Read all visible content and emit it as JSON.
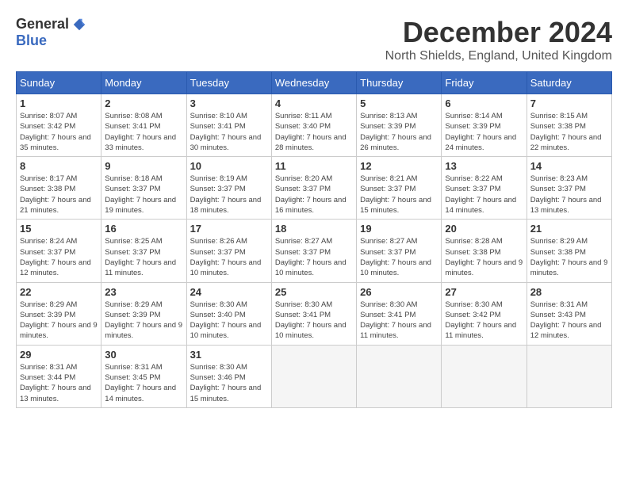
{
  "logo": {
    "general": "General",
    "blue": "Blue"
  },
  "title": "December 2024",
  "location": "North Shields, England, United Kingdom",
  "days_of_week": [
    "Sunday",
    "Monday",
    "Tuesday",
    "Wednesday",
    "Thursday",
    "Friday",
    "Saturday"
  ],
  "weeks": [
    [
      {
        "day": "1",
        "sunrise": "Sunrise: 8:07 AM",
        "sunset": "Sunset: 3:42 PM",
        "daylight": "Daylight: 7 hours and 35 minutes."
      },
      {
        "day": "2",
        "sunrise": "Sunrise: 8:08 AM",
        "sunset": "Sunset: 3:41 PM",
        "daylight": "Daylight: 7 hours and 33 minutes."
      },
      {
        "day": "3",
        "sunrise": "Sunrise: 8:10 AM",
        "sunset": "Sunset: 3:41 PM",
        "daylight": "Daylight: 7 hours and 30 minutes."
      },
      {
        "day": "4",
        "sunrise": "Sunrise: 8:11 AM",
        "sunset": "Sunset: 3:40 PM",
        "daylight": "Daylight: 7 hours and 28 minutes."
      },
      {
        "day": "5",
        "sunrise": "Sunrise: 8:13 AM",
        "sunset": "Sunset: 3:39 PM",
        "daylight": "Daylight: 7 hours and 26 minutes."
      },
      {
        "day": "6",
        "sunrise": "Sunrise: 8:14 AM",
        "sunset": "Sunset: 3:39 PM",
        "daylight": "Daylight: 7 hours and 24 minutes."
      },
      {
        "day": "7",
        "sunrise": "Sunrise: 8:15 AM",
        "sunset": "Sunset: 3:38 PM",
        "daylight": "Daylight: 7 hours and 22 minutes."
      }
    ],
    [
      {
        "day": "8",
        "sunrise": "Sunrise: 8:17 AM",
        "sunset": "Sunset: 3:38 PM",
        "daylight": "Daylight: 7 hours and 21 minutes."
      },
      {
        "day": "9",
        "sunrise": "Sunrise: 8:18 AM",
        "sunset": "Sunset: 3:37 PM",
        "daylight": "Daylight: 7 hours and 19 minutes."
      },
      {
        "day": "10",
        "sunrise": "Sunrise: 8:19 AM",
        "sunset": "Sunset: 3:37 PM",
        "daylight": "Daylight: 7 hours and 18 minutes."
      },
      {
        "day": "11",
        "sunrise": "Sunrise: 8:20 AM",
        "sunset": "Sunset: 3:37 PM",
        "daylight": "Daylight: 7 hours and 16 minutes."
      },
      {
        "day": "12",
        "sunrise": "Sunrise: 8:21 AM",
        "sunset": "Sunset: 3:37 PM",
        "daylight": "Daylight: 7 hours and 15 minutes."
      },
      {
        "day": "13",
        "sunrise": "Sunrise: 8:22 AM",
        "sunset": "Sunset: 3:37 PM",
        "daylight": "Daylight: 7 hours and 14 minutes."
      },
      {
        "day": "14",
        "sunrise": "Sunrise: 8:23 AM",
        "sunset": "Sunset: 3:37 PM",
        "daylight": "Daylight: 7 hours and 13 minutes."
      }
    ],
    [
      {
        "day": "15",
        "sunrise": "Sunrise: 8:24 AM",
        "sunset": "Sunset: 3:37 PM",
        "daylight": "Daylight: 7 hours and 12 minutes."
      },
      {
        "day": "16",
        "sunrise": "Sunrise: 8:25 AM",
        "sunset": "Sunset: 3:37 PM",
        "daylight": "Daylight: 7 hours and 11 minutes."
      },
      {
        "day": "17",
        "sunrise": "Sunrise: 8:26 AM",
        "sunset": "Sunset: 3:37 PM",
        "daylight": "Daylight: 7 hours and 10 minutes."
      },
      {
        "day": "18",
        "sunrise": "Sunrise: 8:27 AM",
        "sunset": "Sunset: 3:37 PM",
        "daylight": "Daylight: 7 hours and 10 minutes."
      },
      {
        "day": "19",
        "sunrise": "Sunrise: 8:27 AM",
        "sunset": "Sunset: 3:37 PM",
        "daylight": "Daylight: 7 hours and 10 minutes."
      },
      {
        "day": "20",
        "sunrise": "Sunrise: 8:28 AM",
        "sunset": "Sunset: 3:38 PM",
        "daylight": "Daylight: 7 hours and 9 minutes."
      },
      {
        "day": "21",
        "sunrise": "Sunrise: 8:29 AM",
        "sunset": "Sunset: 3:38 PM",
        "daylight": "Daylight: 7 hours and 9 minutes."
      }
    ],
    [
      {
        "day": "22",
        "sunrise": "Sunrise: 8:29 AM",
        "sunset": "Sunset: 3:39 PM",
        "daylight": "Daylight: 7 hours and 9 minutes."
      },
      {
        "day": "23",
        "sunrise": "Sunrise: 8:29 AM",
        "sunset": "Sunset: 3:39 PM",
        "daylight": "Daylight: 7 hours and 9 minutes."
      },
      {
        "day": "24",
        "sunrise": "Sunrise: 8:30 AM",
        "sunset": "Sunset: 3:40 PM",
        "daylight": "Daylight: 7 hours and 10 minutes."
      },
      {
        "day": "25",
        "sunrise": "Sunrise: 8:30 AM",
        "sunset": "Sunset: 3:41 PM",
        "daylight": "Daylight: 7 hours and 10 minutes."
      },
      {
        "day": "26",
        "sunrise": "Sunrise: 8:30 AM",
        "sunset": "Sunset: 3:41 PM",
        "daylight": "Daylight: 7 hours and 11 minutes."
      },
      {
        "day": "27",
        "sunrise": "Sunrise: 8:30 AM",
        "sunset": "Sunset: 3:42 PM",
        "daylight": "Daylight: 7 hours and 11 minutes."
      },
      {
        "day": "28",
        "sunrise": "Sunrise: 8:31 AM",
        "sunset": "Sunset: 3:43 PM",
        "daylight": "Daylight: 7 hours and 12 minutes."
      }
    ],
    [
      {
        "day": "29",
        "sunrise": "Sunrise: 8:31 AM",
        "sunset": "Sunset: 3:44 PM",
        "daylight": "Daylight: 7 hours and 13 minutes."
      },
      {
        "day": "30",
        "sunrise": "Sunrise: 8:31 AM",
        "sunset": "Sunset: 3:45 PM",
        "daylight": "Daylight: 7 hours and 14 minutes."
      },
      {
        "day": "31",
        "sunrise": "Sunrise: 8:30 AM",
        "sunset": "Sunset: 3:46 PM",
        "daylight": "Daylight: 7 hours and 15 minutes."
      },
      null,
      null,
      null,
      null
    ]
  ]
}
